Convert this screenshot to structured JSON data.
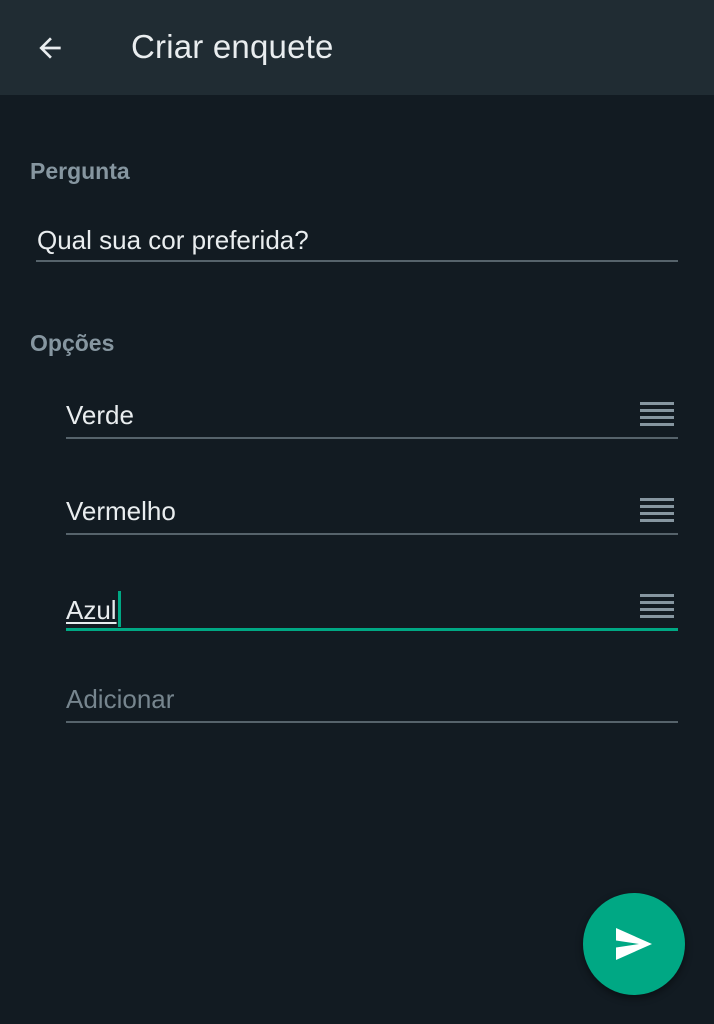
{
  "appbar": {
    "title": "Criar enquete",
    "back_icon": "arrow-left-icon"
  },
  "question": {
    "label": "Pergunta",
    "value": "Qual sua cor preferida?"
  },
  "options": {
    "label": "Opções",
    "items": [
      {
        "value": "Verde",
        "handle_icon": "drag-handle-icon"
      },
      {
        "value": "Vermelho",
        "handle_icon": "drag-handle-icon"
      },
      {
        "value": "Azul",
        "handle_icon": "drag-handle-icon",
        "focused": true
      }
    ],
    "add_placeholder": "Adicionar"
  },
  "send_button": {
    "icon": "send-icon"
  },
  "colors": {
    "background": "#121b22",
    "appbar": "#202c33",
    "accent": "#00a884",
    "label": "#8696a0",
    "text": "#e9edef",
    "divider": "#56636b"
  }
}
